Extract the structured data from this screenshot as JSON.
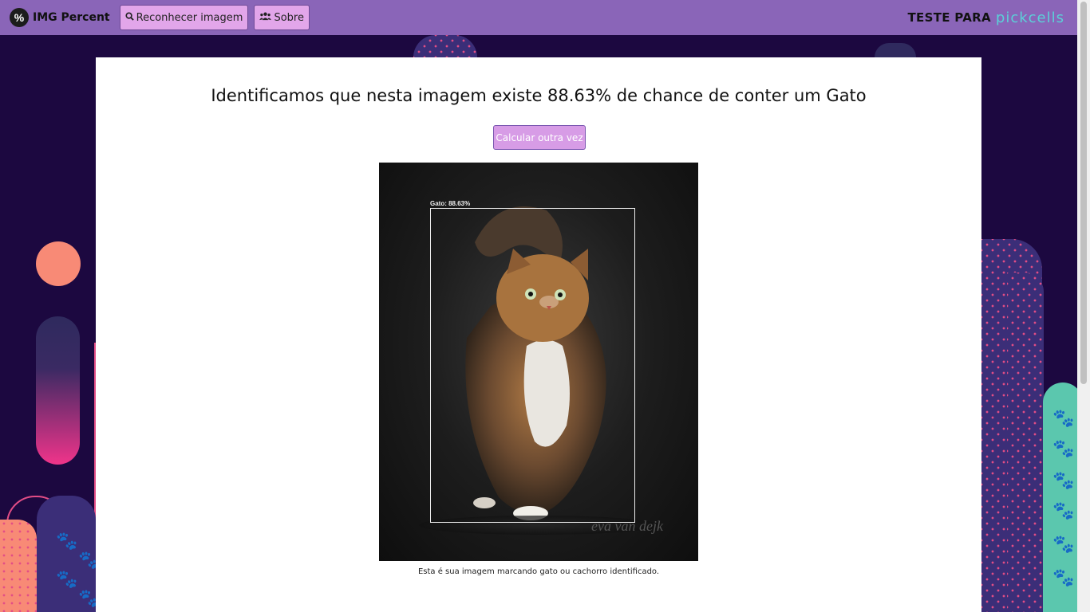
{
  "navbar": {
    "brand_icon": "%",
    "brand_text": "IMG Percent",
    "buttons": [
      {
        "icon": "search-icon",
        "label": "Reconhecer imagem"
      },
      {
        "icon": "users-icon",
        "label": "Sobre"
      }
    ],
    "right_text": "TESTE PARA",
    "right_logo_text": "pickcells"
  },
  "main": {
    "title": "Identificamos que nesta imagem existe 88.63% de chance de conter um Gato",
    "recalc_button": "Calcular outra vez",
    "image": {
      "detection_label": "Gato: 88.63%",
      "watermark": "eva van dejk"
    },
    "caption": "Esta é sua imagem marcando gato ou cachorro identificado."
  },
  "colors": {
    "navbar": "#8a65b8",
    "button": "#e2a6ea",
    "background": "#1c0840",
    "accent_pink": "#e24d86",
    "accent_teal": "#5bd0d8"
  }
}
